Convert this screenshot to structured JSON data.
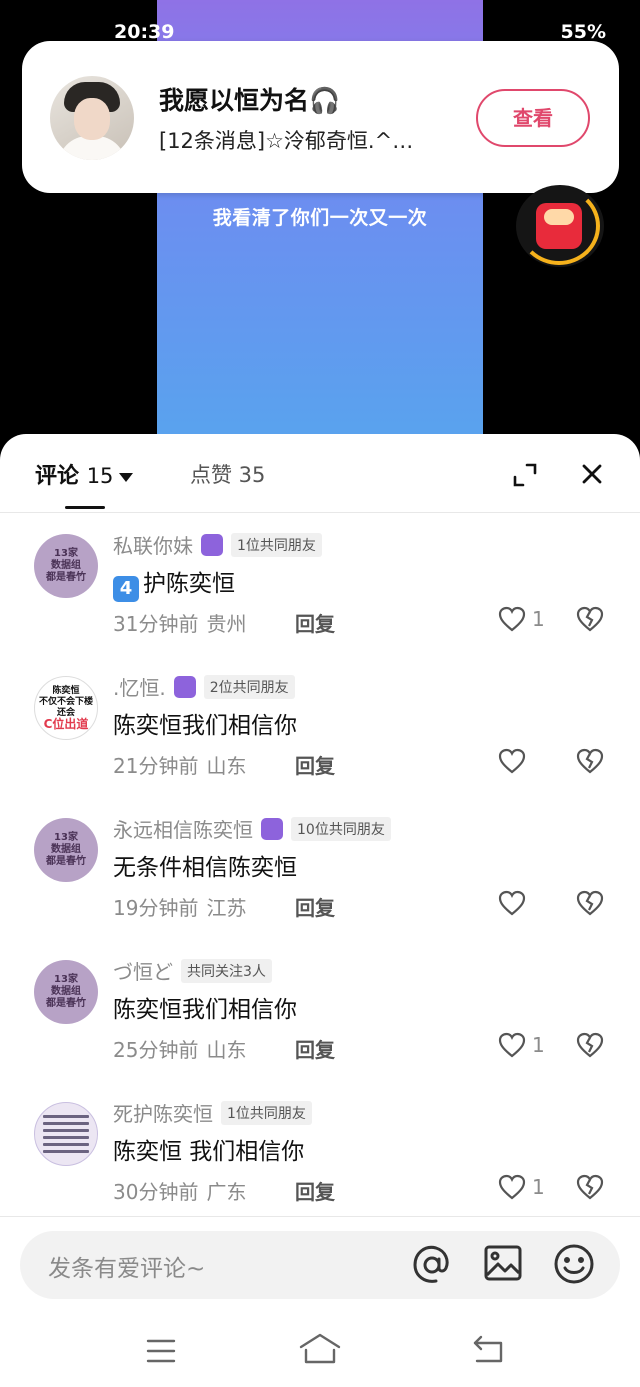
{
  "status_bar": {
    "time": "20:39",
    "battery": "55%"
  },
  "video": {
    "lyric": "我看清了你们一次又一次"
  },
  "notification": {
    "title": "我愿以恒为名🎧",
    "message": "[12条消息]☆泠郁奇恒.^…",
    "view_button": "查看"
  },
  "comments_panel": {
    "tab_comments_label": "评论",
    "tab_comments_count": "15",
    "tab_likes_label": "点赞 35",
    "input_placeholder": "发条有爱评论~"
  },
  "comments": [
    {
      "avatar_text": [
        "13家",
        "数据组",
        "都是春竹"
      ],
      "username": "私联你妹",
      "has_badge": true,
      "tag": "1位共同朋友",
      "number_emoji": "4",
      "text": "护陈奕恒",
      "time": "31分钟前",
      "location": "贵州",
      "reply": "回复",
      "likes": "1"
    },
    {
      "avatar_text": [
        "陈奕恒",
        "不仅不会下楼",
        "还会",
        "C位出道"
      ],
      "username": ".忆恒.",
      "has_badge": true,
      "tag": "2位共同朋友",
      "text": "陈奕恒我们相信你",
      "time": "21分钟前",
      "location": "山东",
      "reply": "回复",
      "likes": ""
    },
    {
      "avatar_text": [
        "13家",
        "数据组",
        "都是春竹"
      ],
      "username": "永远相信陈奕恒",
      "has_badge": true,
      "tag": "10位共同朋友",
      "text": "无条件相信陈奕恒",
      "time": "19分钟前",
      "location": "江苏",
      "reply": "回复",
      "likes": ""
    },
    {
      "avatar_text": [
        "13家",
        "数据组",
        "都是春竹"
      ],
      "username": "づ恒ど",
      "has_badge": false,
      "tag": "共同关注3人",
      "text": "陈奕恒我们相信你",
      "time": "25分钟前",
      "location": "山东",
      "reply": "回复",
      "likes": "1"
    },
    {
      "username": "死护陈奕恒",
      "has_badge": false,
      "tag": "1位共同朋友",
      "text": "陈奕恒  我们相信你",
      "time": "30分钟前",
      "location": "广东",
      "reply": "回复",
      "likes": "1"
    }
  ]
}
